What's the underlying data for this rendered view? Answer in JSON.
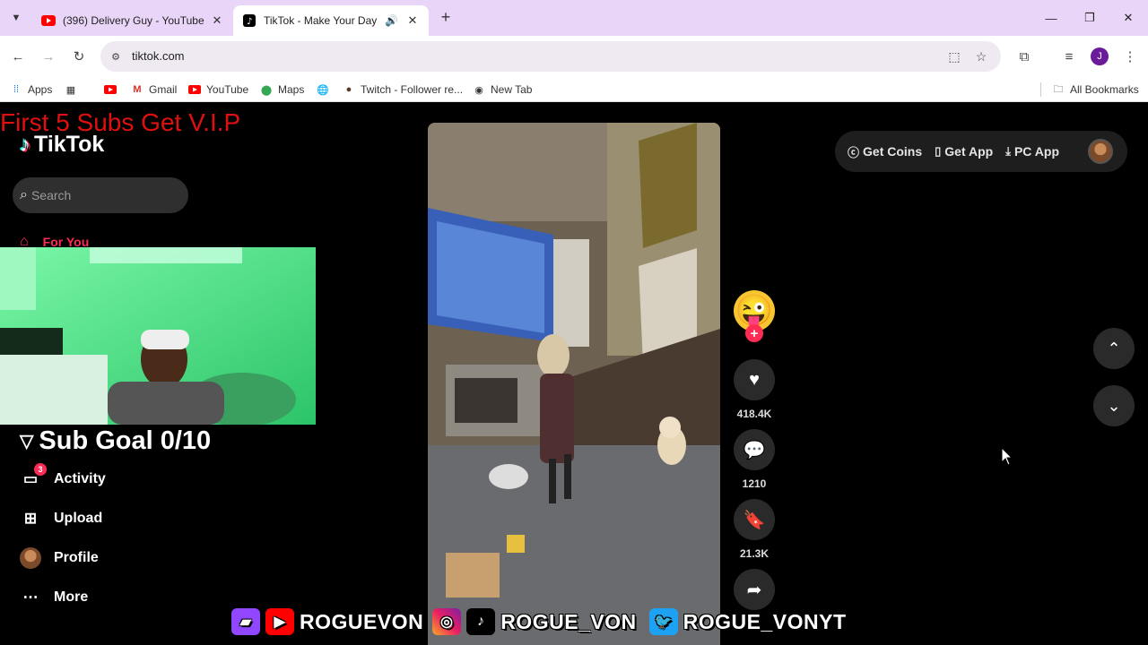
{
  "browser": {
    "tabs": [
      {
        "title": "(396) Delivery Guy - YouTube",
        "active": false
      },
      {
        "title": "TikTok - Make Your Day",
        "active": true
      }
    ],
    "url": "tiktok.com",
    "profile_initial": "J",
    "bookmarks": [
      "Apps",
      "Gmail",
      "YouTube",
      "Maps",
      "Twitch - Follower re...",
      "New Tab"
    ],
    "all_bookmarks": "All Bookmarks"
  },
  "tiktok": {
    "logo_text": "TikTok",
    "search_placeholder": "Search",
    "nav": {
      "for_you": "For You",
      "activity": "Activity",
      "activity_badge": "3",
      "upload": "Upload",
      "profile": "Profile",
      "more": "More"
    },
    "topbar": {
      "get_coins": "Get Coins",
      "get_app": "Get App",
      "pc_app": "PC App"
    },
    "actions": {
      "likes": "418.4K",
      "comments": "1210",
      "saves": "21.3K"
    }
  },
  "stream_overlay": {
    "headline": "First 5 Subs Get V.I.P",
    "sub_goal": "Sub Goal 0/10",
    "social": {
      "youtube": "ROGUEVON",
      "tiktok": "ROGUE_VON",
      "twitter": "ROGUE_VONYT"
    }
  },
  "colors": {
    "tabstrip": "#e9d5f7",
    "tiktok_red": "#fe2c55",
    "overlay_red": "#e01010"
  }
}
